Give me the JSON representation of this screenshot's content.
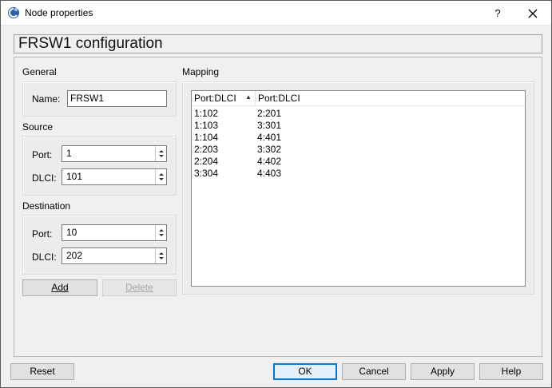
{
  "window": {
    "title": "Node properties",
    "help_glyph": "?"
  },
  "header": {
    "title": "FRSW1  configuration"
  },
  "general": {
    "label": "General",
    "name_label": "Name:",
    "name_value": "FRSW1"
  },
  "source": {
    "label": "Source",
    "port_label": "Port:",
    "port_value": "1",
    "dlci_label": "DLCI:",
    "dlci_value": "101"
  },
  "destination": {
    "label": "Destination",
    "port_label": "Port:",
    "port_value": "10",
    "dlci_label": "DLCI:",
    "dlci_value": "202"
  },
  "actions": {
    "add": "Add",
    "delete": "Delete"
  },
  "mapping": {
    "label": "Mapping",
    "columns": [
      "Port:DLCI",
      "Port:DLCI"
    ],
    "sort_glyph": "▲",
    "rows": [
      [
        "1:102",
        "2:201"
      ],
      [
        "1:103",
        "3:301"
      ],
      [
        "1:104",
        "4:401"
      ],
      [
        "2:203",
        "3:302"
      ],
      [
        "2:204",
        "4:402"
      ],
      [
        "3:304",
        "4:403"
      ]
    ]
  },
  "footer": {
    "reset": "Reset",
    "ok": "OK",
    "cancel": "Cancel",
    "apply": "Apply",
    "help": "Help"
  },
  "colors": {
    "focus_border": "#0078d7",
    "window_bg": "#f0f0f0"
  }
}
